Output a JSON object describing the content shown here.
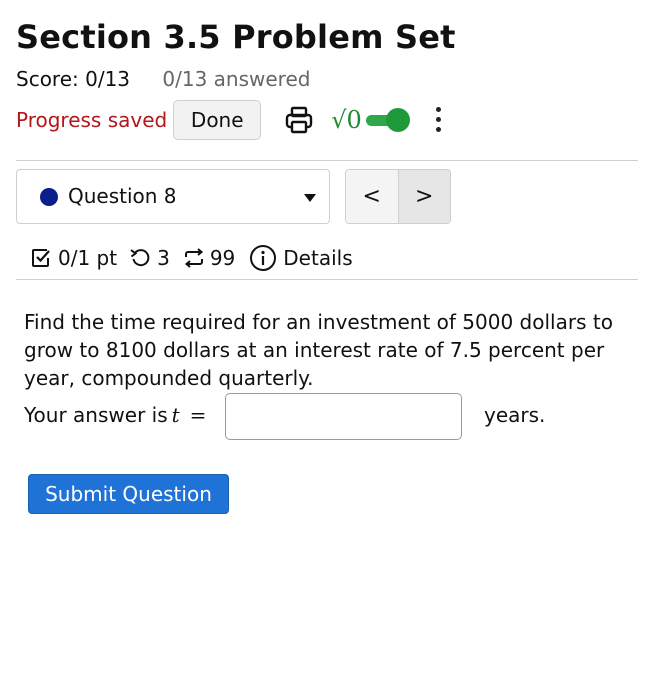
{
  "header": {
    "title": "Section 3.5 Problem Set",
    "score": "Score: 0/13",
    "answered": "0/13 answered"
  },
  "toolbar": {
    "progress_status": "Progress saved",
    "done_label": "Done",
    "print_icon": "printer-icon",
    "math_icon_label": "√0",
    "math_toggle_on": true,
    "more_icon": "kebab-menu-icon"
  },
  "question_nav": {
    "selected_question": "Question 8",
    "prev_label": "<",
    "next_label": ">"
  },
  "meta": {
    "points": "0/1 pt",
    "attempts": "3",
    "retries": "99",
    "details_label": "Details"
  },
  "question": {
    "text": "Find the time required for an investment of 5000 dollars to grow to 8100 dollars at an interest rate of 7.5 percent per year, compounded quarterly.",
    "answer_prefix": "Your answer is",
    "variable": "t",
    "equals": "=",
    "answer_value": "",
    "unit": "years."
  },
  "actions": {
    "submit_label": "Submit Question"
  },
  "colors": {
    "saved_red": "#b3161b",
    "toggle_green": "#1f9a3a",
    "submit_blue": "#1f73d6",
    "question_dot": "#0a1e8c"
  }
}
